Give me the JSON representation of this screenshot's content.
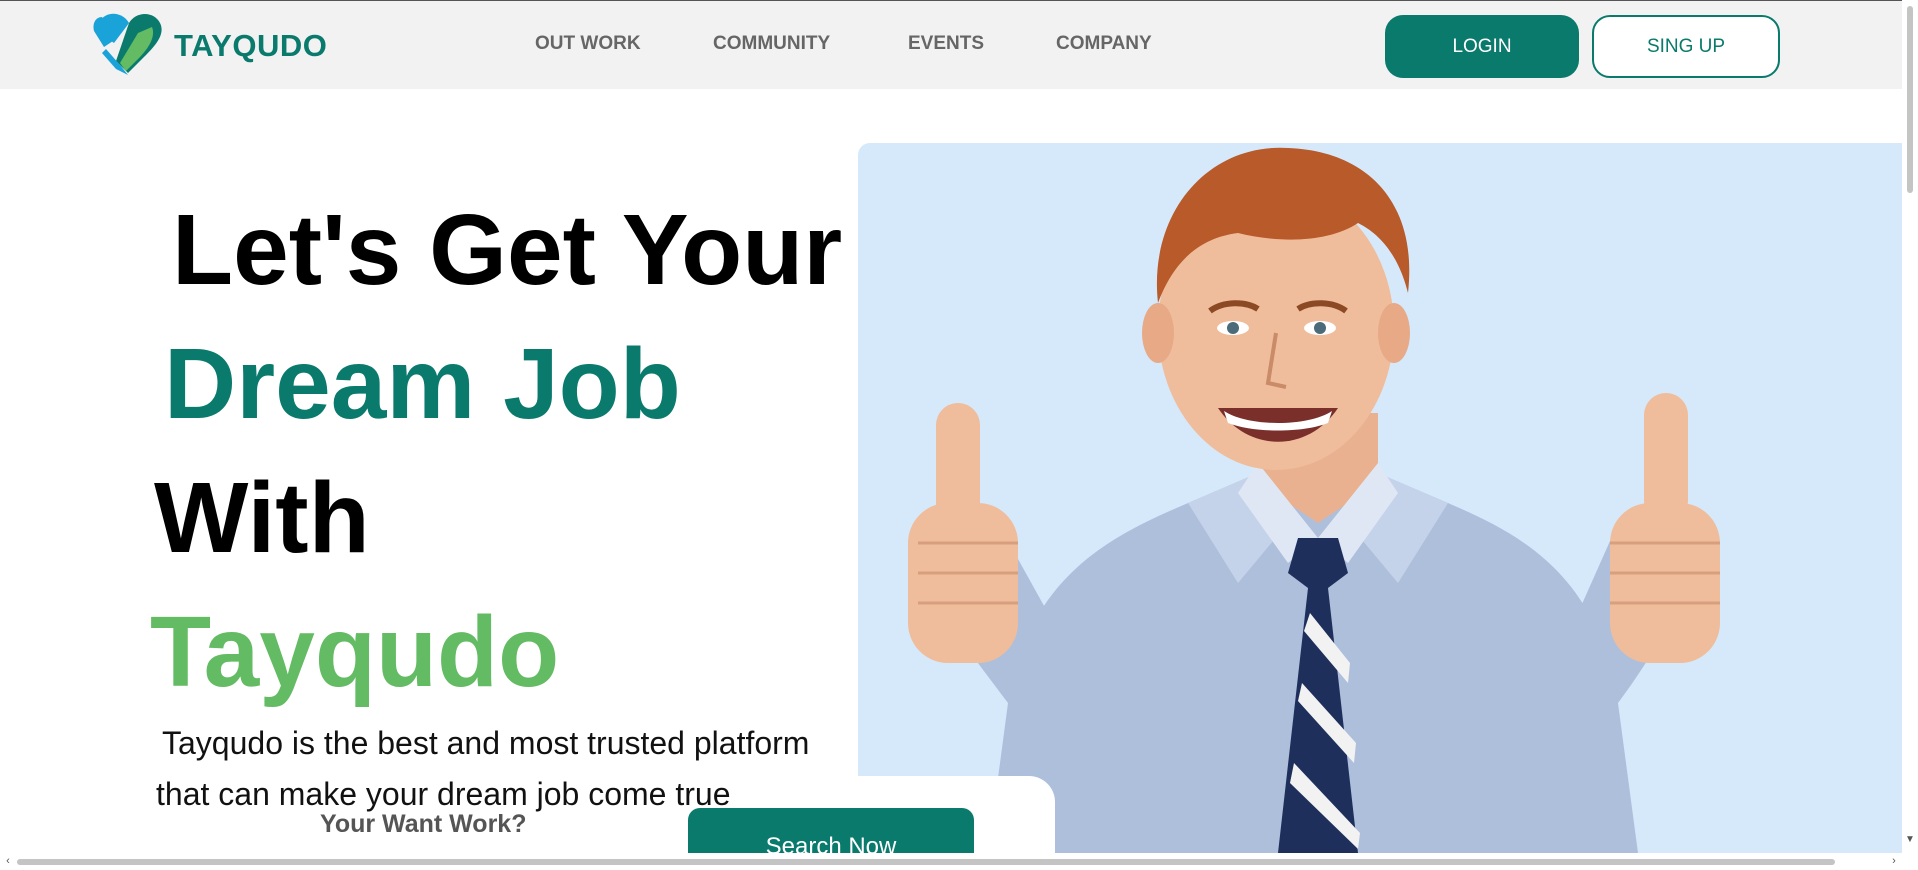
{
  "brand": {
    "name": "TAYQUDO"
  },
  "nav": {
    "items": [
      {
        "label": "OUT WORK"
      },
      {
        "label": "COMMUNITY"
      },
      {
        "label": "EVENTS"
      },
      {
        "label": "COMPANY"
      }
    ]
  },
  "auth": {
    "login_label": "LOGIN",
    "signup_label": "SING UP"
  },
  "hero": {
    "line1": "Let's Get Your",
    "line2": "Dream Job",
    "line3": "With",
    "line4": "Tayqudo",
    "desc_line1": "Tayqudo is the best and most trusted platform",
    "desc_line2": "that can make your dream job come true",
    "image_alt": "smiling man giving two thumbs up"
  },
  "search": {
    "label": "Your Want Work?",
    "button_label": "Search Now"
  },
  "colors": {
    "brand_teal": "#0a7a6d",
    "brand_green": "#63bb63",
    "hero_bg": "#d6e9fb",
    "header_bg": "#f2f2f2"
  },
  "icons": {
    "logo": "heart-logo-icon",
    "scroll_left": "chevron-left-icon",
    "scroll_right": "chevron-right-icon",
    "scroll_down": "chevron-down-icon"
  }
}
